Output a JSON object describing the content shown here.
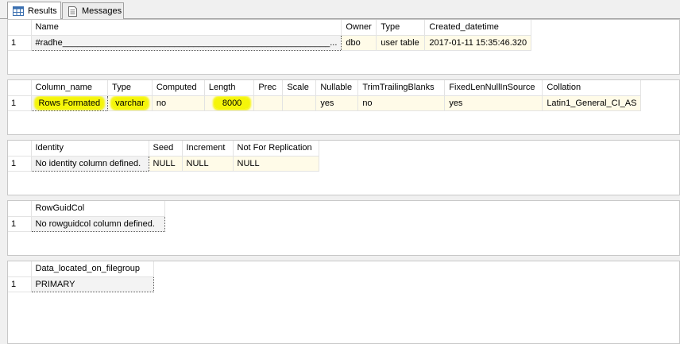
{
  "tabs": [
    {
      "label": "Results",
      "icon": "grid-results-icon"
    },
    {
      "label": "Messages",
      "icon": "messages-icon"
    }
  ],
  "grids": [
    {
      "columns": [
        "Name",
        "Owner",
        "Type",
        "Created_datetime"
      ],
      "rows": [
        {
          "num": "1",
          "cells": [
            "#radhe_______________________________________________________...",
            "dbo",
            "user table",
            "2017-01-11 15:35:46.320"
          ]
        }
      ]
    },
    {
      "columns": [
        "Column_name",
        "Type",
        "Computed",
        "Length",
        "Prec",
        "Scale",
        "Nullable",
        "TrimTrailingBlanks",
        "FixedLenNullInSource",
        "Collation"
      ],
      "rows": [
        {
          "num": "1",
          "cells": [
            "Rows Formated",
            "varchar",
            "no",
            "8000",
            "",
            "",
            "yes",
            "no",
            "yes",
            "Latin1_General_CI_AS"
          ]
        }
      ]
    },
    {
      "columns": [
        "Identity",
        "Seed",
        "Increment",
        "Not For Replication"
      ],
      "rows": [
        {
          "num": "1",
          "cells": [
            "No identity column defined.",
            "NULL",
            "NULL",
            "NULL"
          ]
        }
      ]
    },
    {
      "columns": [
        "RowGuidCol"
      ],
      "rows": [
        {
          "num": "1",
          "cells": [
            "No rowguidcol column defined."
          ]
        }
      ]
    },
    {
      "columns": [
        "Data_located_on_filegroup"
      ],
      "rows": [
        {
          "num": "1",
          "cells": [
            "PRIMARY"
          ]
        }
      ]
    }
  ],
  "colors": {
    "highlight": "#f5f50a",
    "cell_background": "#fffbe8",
    "pane_background": "#f0f0f0"
  }
}
